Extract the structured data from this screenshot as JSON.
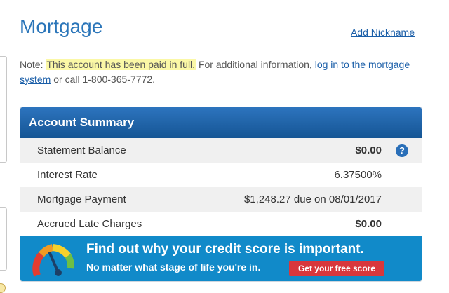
{
  "page": {
    "title": "Mortgage",
    "add_nickname": "Add Nickname"
  },
  "note": {
    "prefix": "Note: ",
    "highlight": "This account has been paid in full.",
    "middle": " For additional information, ",
    "link": "log in to the mortgage system",
    "suffix": " or call 1-800-365-7772."
  },
  "summary": {
    "title": "Account Summary",
    "rows": [
      {
        "label": "Statement Balance",
        "value": "$0.00"
      },
      {
        "label": "Interest Rate",
        "value": "6.37500%"
      },
      {
        "label": "Mortgage Payment",
        "value": "$1,248.27 due on 08/01/2017"
      },
      {
        "label": "Accrued Late Charges",
        "value": "$0.00"
      }
    ],
    "help_glyph": "?"
  },
  "banner": {
    "title": "Find out why your credit score is important.",
    "subtitle": "No matter what stage of life you're in.",
    "button": "Get your free score",
    "icon": "credit-gauge-icon"
  },
  "colors": {
    "title_blue": "#2a75b9",
    "header_blue": "#1f66aa",
    "banner_blue": "#118ac9",
    "button_red": "#d8373c",
    "highlight": "#fbf8a6"
  }
}
